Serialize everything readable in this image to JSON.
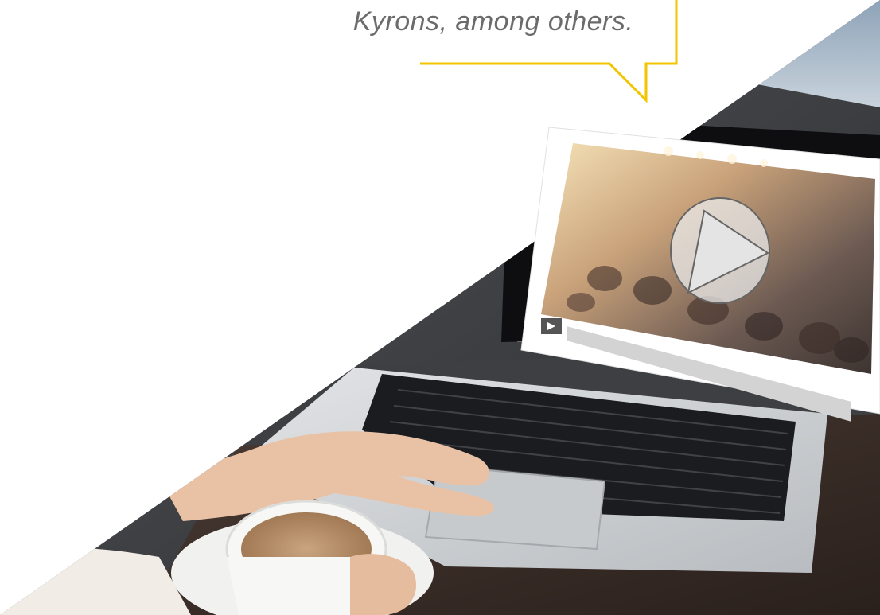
{
  "quote_text": "Kyrons, among others.",
  "colors": {
    "bubble_outline": "#f2c500",
    "quote_text": "#6b6b6b"
  },
  "icons": {
    "play_overlay": "play-circle-icon",
    "player_play_button": "play-icon"
  }
}
